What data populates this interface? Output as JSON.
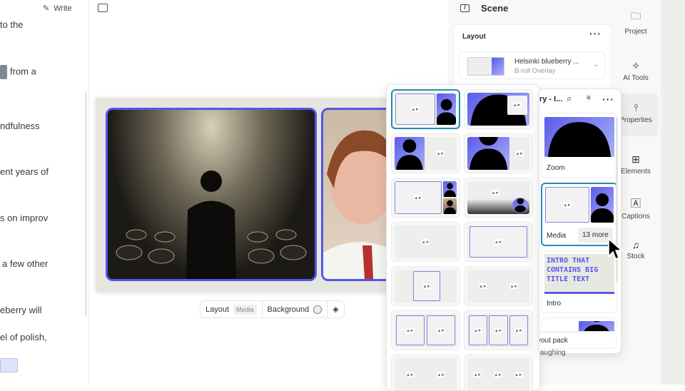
{
  "transcript": {
    "write_label": "Write",
    "lines": [
      "to the",
      "from a",
      "ndfulness",
      "ent years of",
      "s on improv",
      "a few other",
      "eberry will",
      "el of polish,"
    ]
  },
  "canvas": {
    "bottom_bar": {
      "layout_label": "Layout",
      "layout_badge": "Media",
      "background_label": "Background"
    }
  },
  "scene_panel": {
    "title": "Scene",
    "layout_section": "Layout",
    "current_layout": {
      "name": "Helsinki blueberry ...",
      "type": "B-roll Overlay"
    }
  },
  "rail": [
    {
      "label": "Project",
      "icon": "folder-icon"
    },
    {
      "label": "AI Tools",
      "icon": "sparkle-icon"
    },
    {
      "label": "Properties",
      "icon": "sliders-icon",
      "active": true
    },
    {
      "label": "Elements",
      "icon": "elements-icon"
    },
    {
      "label": "Captions",
      "icon": "captions-icon"
    },
    {
      "label": "Stock",
      "icon": "stock-icon"
    }
  ],
  "layout_picker": {
    "cells": [
      "media-split-person",
      "person-pip-media",
      "person-left-media",
      "person-wide-media",
      "media-two-persons",
      "media-circle-person",
      "media-full",
      "media-framed",
      "media-small-center",
      "two-media-plain",
      "two-media-framed",
      "three-media-framed",
      "two-media-plain",
      "three-media-plain"
    ],
    "selected": 0
  },
  "layout_pack": {
    "title": "ry - I...",
    "items": [
      {
        "label": "Zoom"
      },
      {
        "label": "Media",
        "more": "13 more",
        "selected": true
      },
      {
        "label": "Intro",
        "intro_text": "INTRO THAT CONTAINS BIG TITLE TEXT"
      }
    ],
    "footer": "yout pack",
    "below": "aughing"
  },
  "colors": {
    "accent": "#5157e8",
    "selection": "#1f8fb0"
  }
}
